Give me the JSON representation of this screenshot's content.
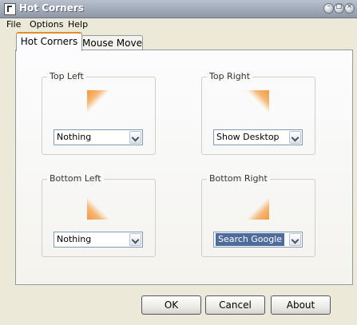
{
  "window": {
    "title": "Hot Corners"
  },
  "menu": {
    "items": [
      "File",
      "Options",
      "Help"
    ]
  },
  "tabs": [
    {
      "label": "Hot Corners",
      "active": true
    },
    {
      "label": "Mouse Move",
      "active": false
    }
  ],
  "corners": {
    "top_left": {
      "label": "Top Left",
      "value": "Nothing"
    },
    "top_right": {
      "label": "Top Right",
      "value": "Show Desktop"
    },
    "bottom_left": {
      "label": "Bottom Left",
      "value": "Nothing"
    },
    "bottom_right": {
      "label": "Bottom Right",
      "value": "Search Google"
    }
  },
  "buttons": {
    "ok": "OK",
    "cancel": "Cancel",
    "about": "About"
  },
  "colors": {
    "accent": "#f39a3a",
    "selection": "#4f6b9b",
    "tab_highlight": "#e68b2c"
  }
}
